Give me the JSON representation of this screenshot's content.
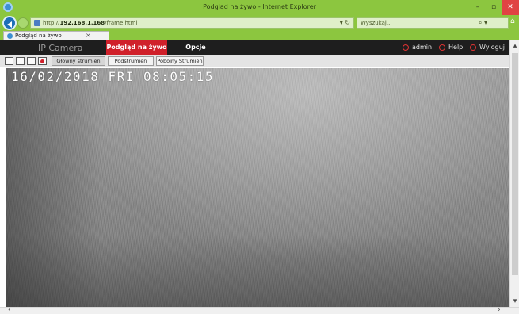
{
  "window": {
    "title": "Podgląd na żywo - Internet Explorer",
    "min_glyph": "–",
    "max_glyph": "▫",
    "close_glyph": "✕"
  },
  "nav": {
    "url_prefix": "http://",
    "url_host": "192.168.1.168",
    "url_path": "/frame.html",
    "refresh_glyph": "▾ ↻",
    "search_placeholder": "Wyszukaj...",
    "search_glyph": "⌕ ▾",
    "home_glyph": "⌂",
    "star_glyph": "★",
    "gear_glyph": "⚙"
  },
  "tab": {
    "label": "Podgląd na żywo",
    "close_glyph": "×"
  },
  "app": {
    "brand": "IP Camera",
    "menu": {
      "live": "Podgląd na żywo",
      "options": "Opcje"
    },
    "user": "admin",
    "help": "Help",
    "logout": "Wyloguj"
  },
  "toolbar": {
    "main_stream": "Główny strumień",
    "sub_stream": "Podstrumień",
    "third_stream": "Pobójny Strumień"
  },
  "video": {
    "osd_timestamp": "16/02/2018 FRI 08:05:15"
  },
  "scroll": {
    "up_glyph": "▴",
    "down_glyph": "▾",
    "left_glyph": "‹",
    "right_glyph": "›"
  },
  "colors": {
    "chrome_green": "#8cc63f",
    "brand_red": "#d0202a",
    "header_dark": "#1e1e1e"
  }
}
